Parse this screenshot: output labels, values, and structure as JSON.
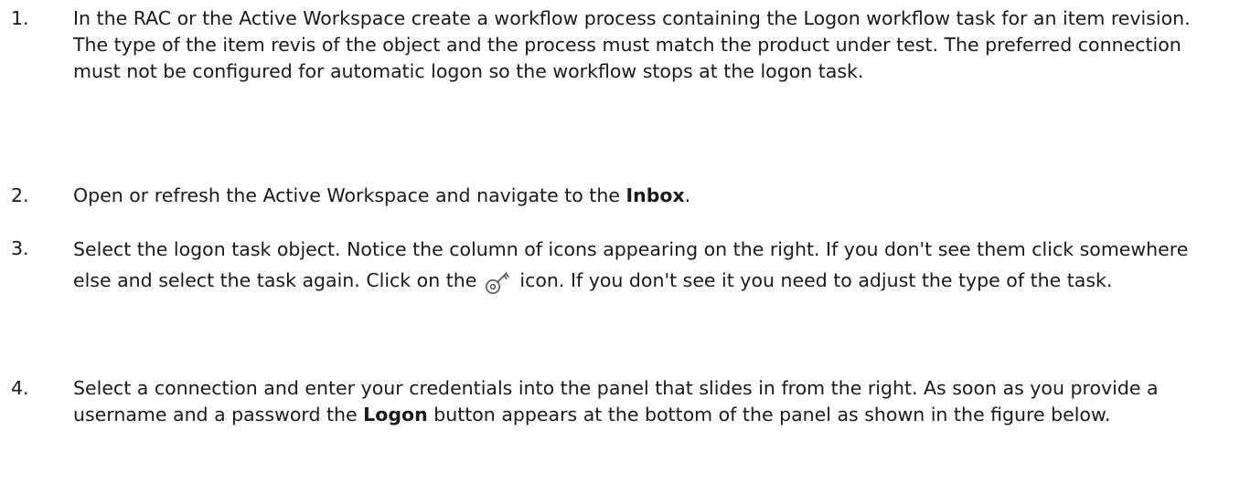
{
  "steps": [
    {
      "number": "1.",
      "text": "In the RAC or the Active Workspace create a workflow process containing the Logon workflow task for an item revision. The type of the item revis of the object and the process must match the product under test. The preferred connection must not be configured for automatic logon so the workflow stops at the logon task."
    },
    {
      "number": "2.",
      "text_before": "Open or refresh the Active Workspace and navigate to the ",
      "bold": "Inbox",
      "text_after": "."
    },
    {
      "number": "3.",
      "text_before": "Select the logon task object. Notice the column of icons appearing on the right. If you don't see them click somewhere else and select the task again. Click on the ",
      "icon": "key-icon",
      "text_after": " icon. If you don't see it you need to adjust the type of the task."
    },
    {
      "number": "4.",
      "text_before": "Select a connection and enter your credentials into the panel that slides in from the right. As soon as you provide a username and a password the ",
      "bold": "Logon",
      "text_after": " button appears at the bottom of the panel as shown in the figure below."
    }
  ]
}
